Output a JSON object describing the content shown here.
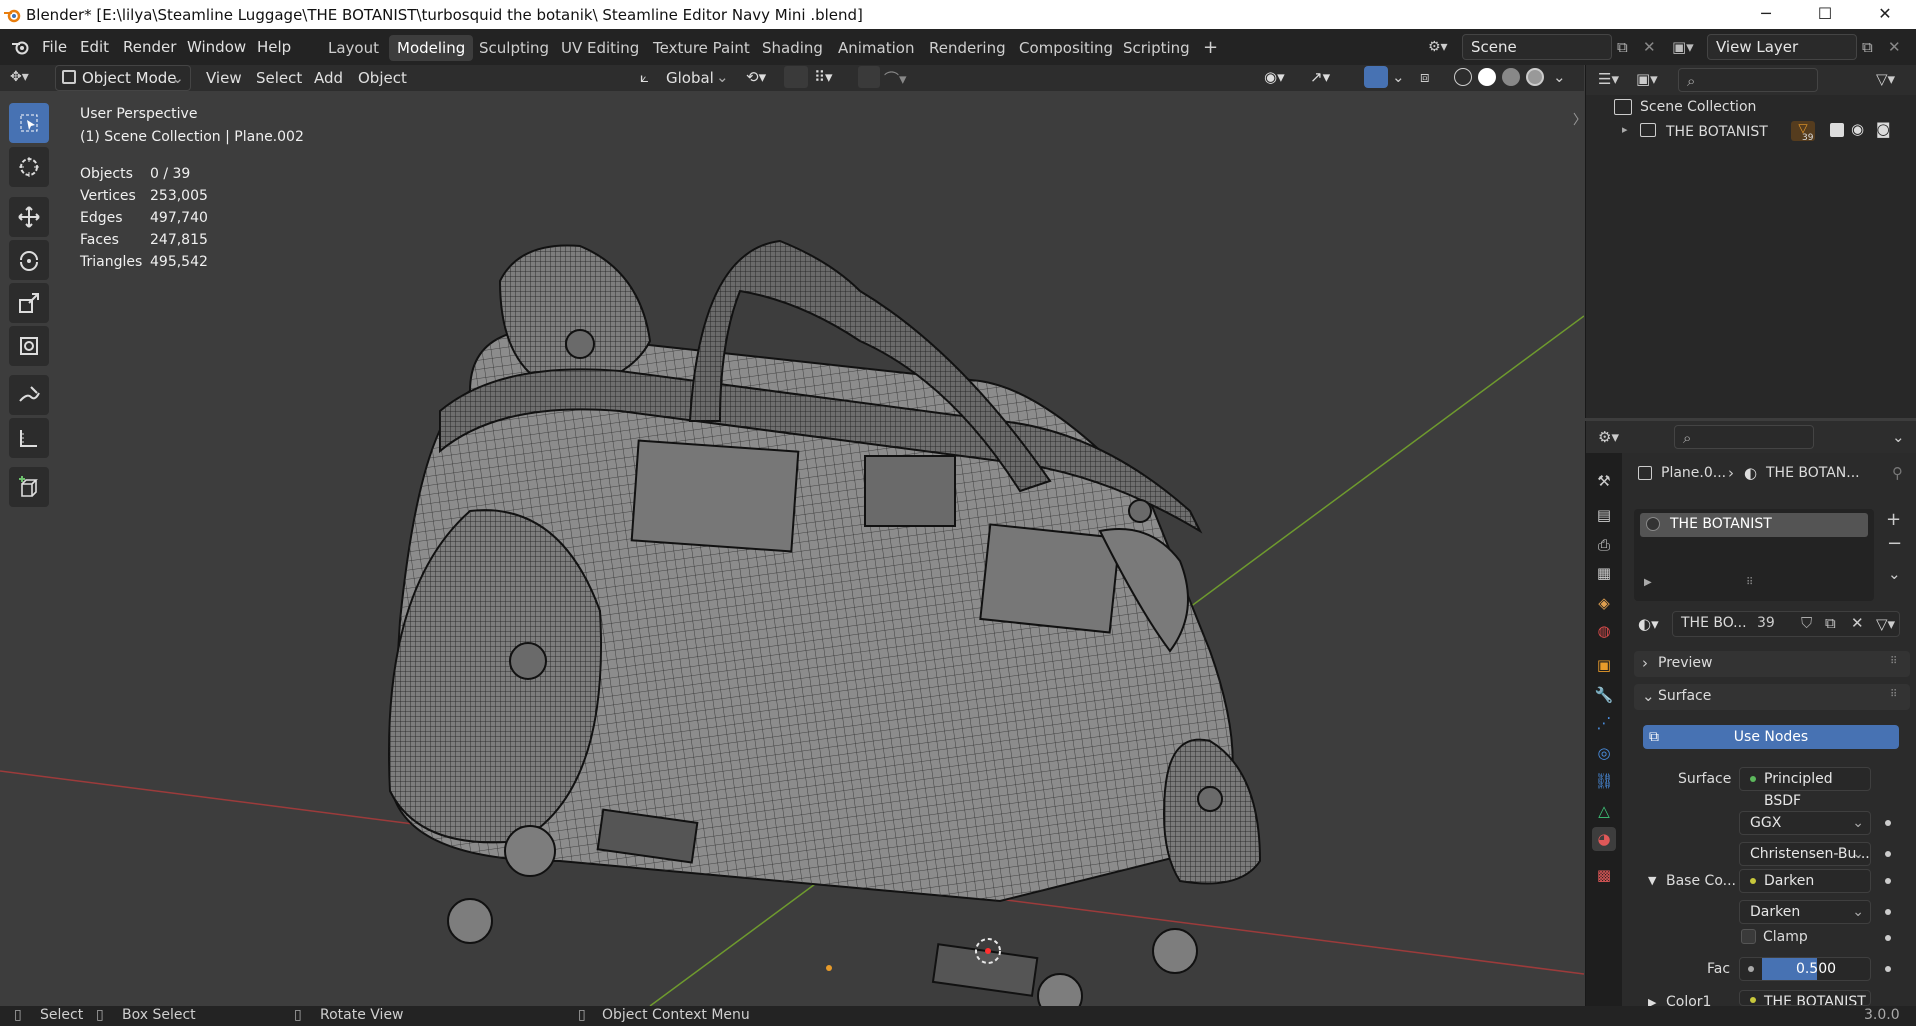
{
  "window": {
    "title": "Blender* [E:\\lilya\\Steamline Luggage\\THE BOTANIST\\turbosquid the botanik\\ Steamline Editor Navy Mini .blend]",
    "minimize": "─",
    "maximize": "☐",
    "close": "✕"
  },
  "menu": {
    "items": [
      "File",
      "Edit",
      "Render",
      "Window",
      "Help"
    ]
  },
  "workspaces": {
    "tabs": [
      "Layout",
      "Modeling",
      "Sculpting",
      "UV Editing",
      "Texture Paint",
      "Shading",
      "Animation",
      "Rendering",
      "Compositing",
      "Scripting"
    ],
    "add": "+",
    "active": "Modeling"
  },
  "scene": {
    "name": "Scene",
    "view_layer": "View Layer"
  },
  "header3d": {
    "mode": "Object Mode",
    "menus": [
      "View",
      "Select",
      "Add",
      "Object"
    ],
    "transform": "Global"
  },
  "viewport": {
    "perspective": "User Perspective",
    "collection": "(1) Scene Collection | Plane.002",
    "stats": [
      {
        "label": "Objects",
        "value": "0 / 39"
      },
      {
        "label": "Vertices",
        "value": "253,005"
      },
      {
        "label": "Edges",
        "value": "497,740"
      },
      {
        "label": "Faces",
        "value": "247,815"
      },
      {
        "label": "Triangles",
        "value": "495,542"
      }
    ]
  },
  "tools": [
    "select-box",
    "cursor",
    "move",
    "rotate",
    "scale",
    "transform",
    "annotate",
    "measure",
    "add-cube"
  ],
  "outliner": {
    "root": "Scene Collection",
    "collection": "THE BOTANIST",
    "count": "39"
  },
  "properties": {
    "breadcrumb_object": "Plane.0...",
    "breadcrumb_material": "THE BOTAN...",
    "slot": "THE BOTANIST",
    "material_short": "THE BO...",
    "users": "39",
    "preview": "Preview",
    "surface_panel": "Surface",
    "use_nodes": "Use Nodes",
    "surface_label": "Surface",
    "surface_value": "Principled BSDF",
    "distribution": "GGX",
    "subsurface": "Christensen-Bu...",
    "base_color_label": "Base Co...",
    "base_color_value": "Darken",
    "blend_mode": "Darken",
    "clamp": "Clamp",
    "fac_label": "Fac",
    "fac_value": "0.500",
    "fac_fraction": 0.5,
    "color1_label": "Color1",
    "color1_value": "THE BOTANIST"
  },
  "statusbar": {
    "select": "Select",
    "box_select": "Box Select",
    "rotate": "Rotate View",
    "context": "Object Context Menu",
    "version": "3.0.0"
  },
  "colors": {
    "accent": "#4772b3",
    "x_axis": "#9c3b3b",
    "y_axis": "#6e9a2e",
    "node_green": "#5cb85c",
    "node_yellow": "#c8c83c"
  }
}
